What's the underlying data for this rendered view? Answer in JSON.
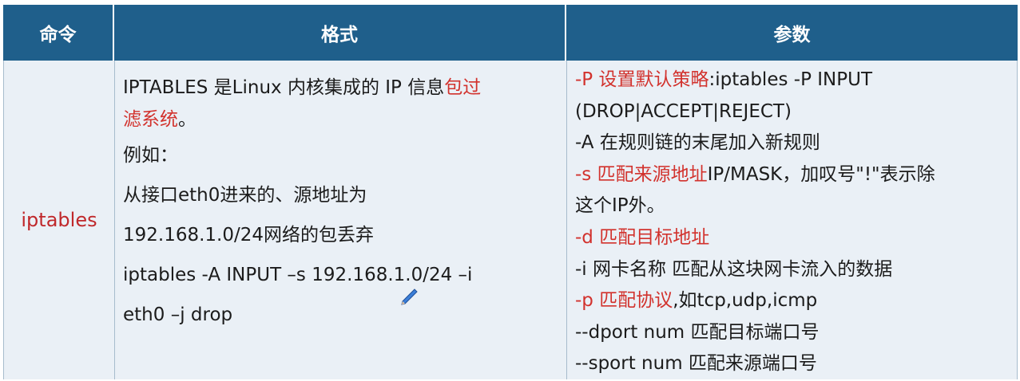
{
  "header": {
    "col1": "命令",
    "col2": "格式",
    "col3": "参数"
  },
  "row": {
    "command": "iptables",
    "format": {
      "line1_a": "IPTABLES 是Linux 内核集成的 IP 信息",
      "line1_b": "包过",
      "line2_a": "滤系统",
      "line2_b": "。",
      "line3": "例如：",
      "line4": "从接口eth0进来的、源地址为",
      "line5": "192.168.1.0/24网络的包丢弃",
      "line6": "iptables -A INPUT –s 192.168.1.0/24 –i",
      "line7": "eth0 –j drop"
    },
    "params": [
      {
        "red": "-P 设置默认策略",
        "rest": ":iptables -P INPUT"
      },
      {
        "red": "",
        "rest": "(DROP|ACCEPT|REJECT)"
      },
      {
        "red": "",
        "rest": "-A 在规则链的末尾加入新规则"
      },
      {
        "red": "-s 匹配来源地址",
        "rest": "IP/MASK，加叹号\"!\"表示除"
      },
      {
        "red": "",
        "rest": "这个IP外。"
      },
      {
        "red": "-d 匹配目标地址",
        "rest": ""
      },
      {
        "red": "",
        "rest": "-i 网卡名称 匹配从这块网卡流入的数据"
      },
      {
        "red": "-p 匹配协议",
        "rest": ",如tcp,udp,icmp"
      },
      {
        "red": "",
        "rest": "--dport num 匹配目标端口号"
      },
      {
        "red": "",
        "rest": "--sport num 匹配来源端口号"
      }
    ]
  },
  "colors": {
    "header_bg": "#1f5f8b",
    "body_bg": "#eaf0f6",
    "accent_red": "#d2322d"
  }
}
